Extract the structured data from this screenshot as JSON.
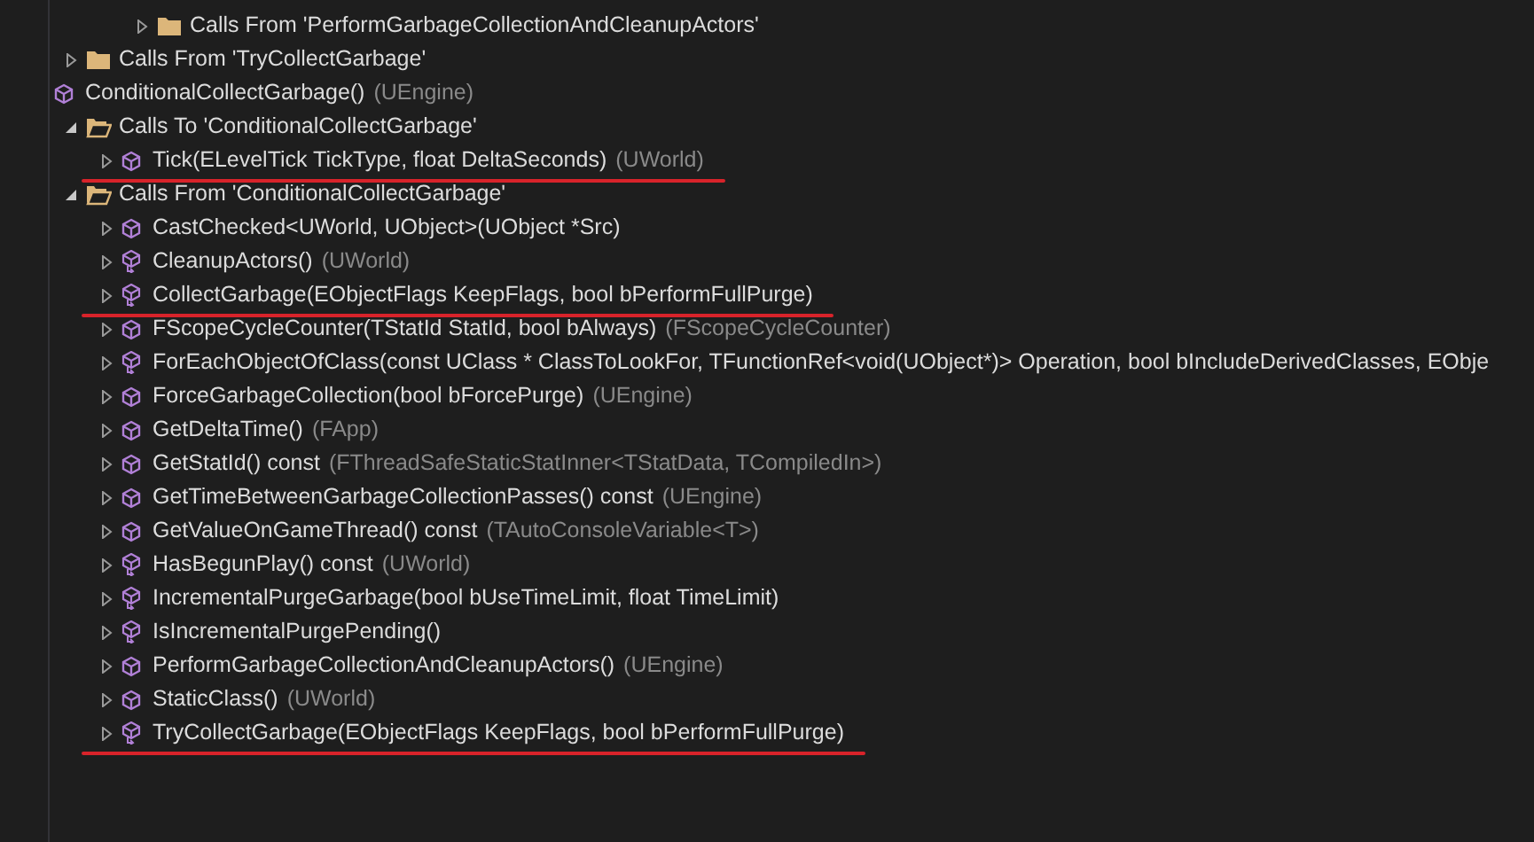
{
  "items": [
    {
      "kind": "hidden",
      "children": [
        {
          "kind": "hidden",
          "children": [
            {
              "kind": "hidden",
              "children": [
                {
                  "kind": "folder",
                  "label": "Calls From 'PerformGarbageCollectionAndCleanupActors'",
                  "expanded": false
                }
              ]
            }
          ]
        },
        {
          "kind": "folder",
          "label": "Calls From 'TryCollectGarbage'",
          "expanded": false
        }
      ]
    },
    {
      "kind": "method",
      "name": "ConditionalCollectGarbage()",
      "owner": "(UEngine)",
      "children": [
        {
          "kind": "folder",
          "label": "Calls To 'ConditionalCollectGarbage'",
          "expanded": true,
          "children": [
            {
              "kind": "method",
              "name": "Tick(ELevelTick TickType, float DeltaSeconds)",
              "owner": "(UWorld)",
              "expanded": false,
              "underlined": true
            }
          ]
        },
        {
          "kind": "folder",
          "label": "Calls From 'ConditionalCollectGarbage'",
          "expanded": true,
          "children": [
            {
              "kind": "method",
              "name": "CastChecked<UWorld, UObject>(UObject *Src)",
              "expanded": false,
              "underlined": false
            },
            {
              "kind": "override_method",
              "name": "CleanupActors()",
              "owner": "(UWorld)",
              "expanded": false,
              "underlined": false
            },
            {
              "kind": "override_method",
              "name": "CollectGarbage(EObjectFlags KeepFlags, bool bPerformFullPurge)",
              "expanded": false,
              "underlined": true
            },
            {
              "kind": "method",
              "name": "FScopeCycleCounter(TStatId StatId, bool bAlways)",
              "owner": "(FScopeCycleCounter)",
              "expanded": false,
              "underlined": false
            },
            {
              "kind": "override_method",
              "name": "ForEachObjectOfClass(const UClass * ClassToLookFor, TFunctionRef<void(UObject*)> Operation, bool bIncludeDerivedClasses, EObje",
              "expanded": false,
              "underlined": false
            },
            {
              "kind": "method",
              "name": "ForceGarbageCollection(bool bForcePurge)",
              "owner": "(UEngine)",
              "expanded": false,
              "underlined": false
            },
            {
              "kind": "method",
              "name": "GetDeltaTime()",
              "owner": "(FApp)",
              "expanded": false,
              "underlined": false
            },
            {
              "kind": "method",
              "name": "GetStatId() const",
              "owner": "(FThreadSafeStaticStatInner<TStatData, TCompiledIn>)",
              "expanded": false,
              "underlined": false
            },
            {
              "kind": "method",
              "name": "GetTimeBetweenGarbageCollectionPasses() const",
              "owner": "(UEngine)",
              "expanded": false,
              "underlined": false
            },
            {
              "kind": "method",
              "name": "GetValueOnGameThread() const",
              "owner": "(TAutoConsoleVariable<T>)",
              "expanded": false,
              "underlined": false
            },
            {
              "kind": "override_method",
              "name": "HasBegunPlay() const",
              "owner": "(UWorld)",
              "expanded": false,
              "underlined": false
            },
            {
              "kind": "override_method",
              "name": "IncrementalPurgeGarbage(bool bUseTimeLimit, float TimeLimit)",
              "expanded": false,
              "underlined": false
            },
            {
              "kind": "override_method",
              "name": "IsIncrementalPurgePending()",
              "expanded": false,
              "underlined": false
            },
            {
              "kind": "method",
              "name": "PerformGarbageCollectionAndCleanupActors()",
              "owner": "(UEngine)",
              "expanded": false,
              "underlined": false
            },
            {
              "kind": "method",
              "name": "StaticClass()",
              "owner": "(UWorld)",
              "expanded": false,
              "underlined": false
            },
            {
              "kind": "override_method",
              "name": "TryCollectGarbage(EObjectFlags KeepFlags, bool bPerformFullPurge)",
              "expanded": false,
              "underlined": true
            }
          ]
        }
      ]
    }
  ]
}
